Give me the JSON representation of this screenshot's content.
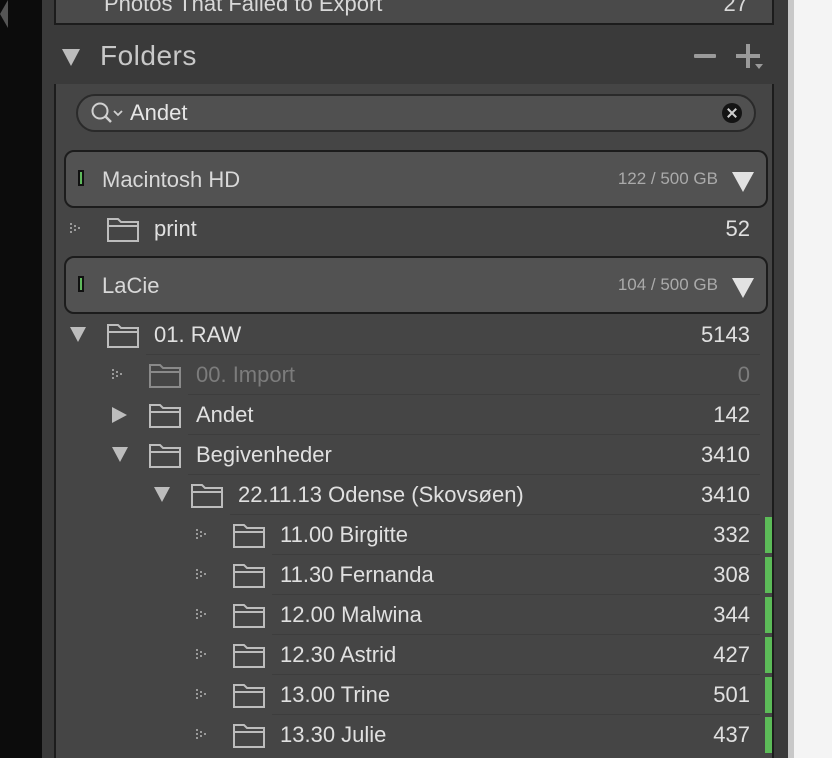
{
  "previous_row": {
    "label": "Photos That Failed to Export",
    "count": "27"
  },
  "panel": {
    "title": "Folders",
    "remove_icon": "minus-icon",
    "add_icon": "plus-dropdown-icon"
  },
  "search": {
    "value": "Andet",
    "icon": "search-icon",
    "clear_icon": "clear-icon"
  },
  "volumes": [
    {
      "name": "Macintosh HD",
      "capacity": "122 / 500 GB",
      "status_color": "#5fba5c"
    },
    {
      "name": "LaCie",
      "capacity": "104 / 500 GB",
      "status_color": "#5fba5c"
    }
  ],
  "folders": [
    {
      "name": "print",
      "count": "52"
    },
    {
      "name": "01. RAW",
      "count": "5143"
    },
    {
      "name": "00. Import",
      "count": "0"
    },
    {
      "name": "Andet",
      "count": "142"
    },
    {
      "name": "Begivenheder",
      "count": "3410"
    },
    {
      "name": "22.11.13 Odense (Skovsøen)",
      "count": "3410"
    },
    {
      "name": "11.00 Birgitte",
      "count": "332"
    },
    {
      "name": "11.30 Fernanda",
      "count": "308"
    },
    {
      "name": "12.00 Malwina",
      "count": "344"
    },
    {
      "name": "12.30 Astrid",
      "count": "427"
    },
    {
      "name": "13.00 Trine",
      "count": "501"
    },
    {
      "name": "13.30 Julie",
      "count": "437"
    }
  ],
  "colors": {
    "panel_bg": "#3a3a3a",
    "tree_bg": "#454545",
    "sync_indicator": "#5cbb58"
  }
}
